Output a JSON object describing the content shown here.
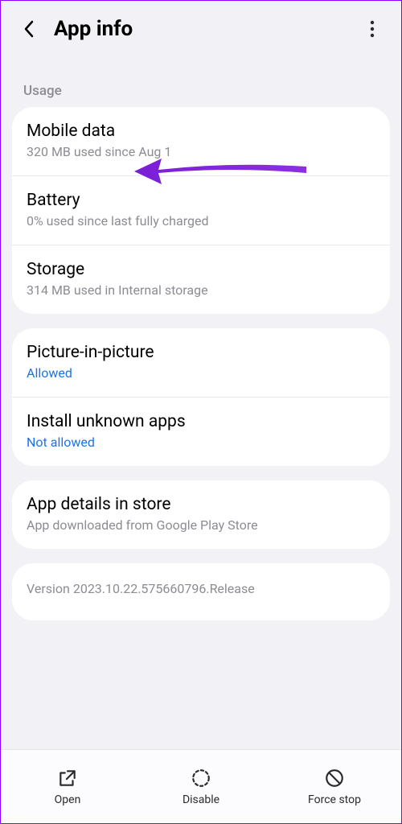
{
  "header": {
    "title": "App info"
  },
  "sectionLabel": "Usage",
  "usage": {
    "mobileData": {
      "title": "Mobile data",
      "sub": "320 MB used since Aug 1"
    },
    "battery": {
      "title": "Battery",
      "sub": "0% used since last fully charged"
    },
    "storage": {
      "title": "Storage",
      "sub": "314 MB used in Internal storage"
    }
  },
  "permissions": {
    "pip": {
      "title": "Picture-in-picture",
      "status": "Allowed"
    },
    "unknown": {
      "title": "Install unknown apps",
      "status": "Not allowed"
    }
  },
  "store": {
    "title": "App details in store",
    "sub": "App downloaded from Google Play Store"
  },
  "version": "Version 2023.10.22.575660796.Release",
  "bottom": {
    "open": "Open",
    "disable": "Disable",
    "forceStop": "Force stop"
  }
}
